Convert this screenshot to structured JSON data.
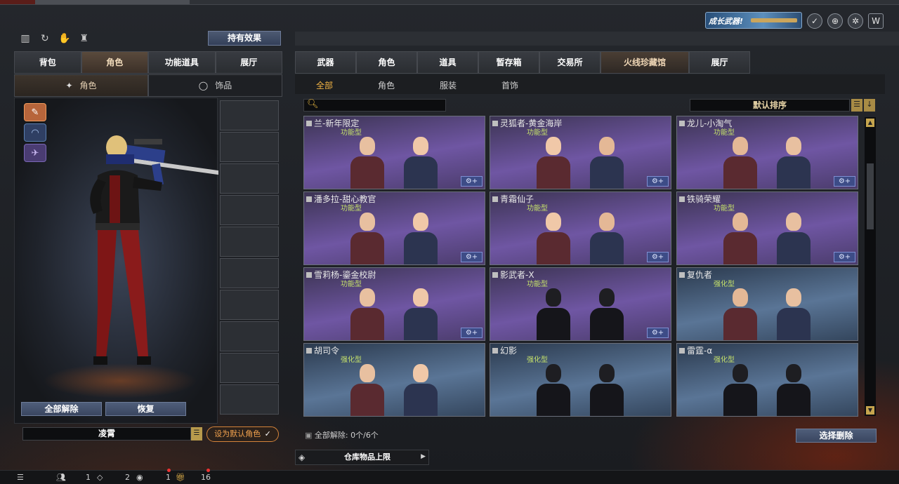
{
  "promo": {
    "label": "成长武器!"
  },
  "left_panel": {
    "effect_button": "持有效果",
    "tabs": [
      "背包",
      "角色",
      "功能道具",
      "展厅"
    ],
    "sub_tabs": [
      {
        "label": "角色",
        "icon": "character-icon"
      },
      {
        "label": "饰品",
        "icon": "ring-icon"
      }
    ],
    "unequip_all": "全部解除",
    "restore": "恢复",
    "character_name": "凌霄",
    "set_default": "设为默认角色",
    "set_default_mark": "✓"
  },
  "right_panel": {
    "tabs": [
      "武器",
      "角色",
      "道具",
      "暂存箱",
      "交易所",
      "火线珍藏馆",
      "展厅"
    ],
    "sub_tabs": [
      "全部",
      "角色",
      "服装",
      "首饰"
    ],
    "search_placeholder": "",
    "sort_label": "默认排序",
    "cards": [
      {
        "name": "兰-新年限定",
        "type": "功能型",
        "style": "purple",
        "add": true
      },
      {
        "name": "灵狐者-黄金海岸",
        "type": "功能型",
        "style": "purple",
        "add": true
      },
      {
        "name": "龙儿-小淘气",
        "type": "功能型",
        "style": "purple",
        "add": true
      },
      {
        "name": "潘多拉-甜心教官",
        "type": "功能型",
        "style": "purple",
        "add": true
      },
      {
        "name": "青霜仙子",
        "type": "功能型",
        "style": "purple",
        "add": true
      },
      {
        "name": "铁骑荣耀",
        "type": "功能型",
        "style": "purple",
        "add": true
      },
      {
        "name": "雪莉杨-鎏金校尉",
        "type": "功能型",
        "style": "purple",
        "add": true
      },
      {
        "name": "影武者-X",
        "type": "功能型",
        "style": "purple",
        "add": true
      },
      {
        "name": "复仇者",
        "type": "强化型",
        "style": "blue",
        "add": false
      },
      {
        "name": "胡司令",
        "type": "强化型",
        "style": "blue",
        "add": false
      },
      {
        "name": "幻影",
        "type": "强化型",
        "style": "blue",
        "add": false
      },
      {
        "name": "雷霆-α",
        "type": "强化型",
        "style": "blue",
        "add": false
      }
    ],
    "unequip_status": "全部解除: 0个/6个",
    "select_delete": "选择删除",
    "warehouse_limit": "仓库物品上限"
  },
  "bottom_bar": {
    "counts": [
      "1",
      "2",
      "1",
      "16"
    ]
  },
  "colors": {
    "accent_orange": "#f3b444",
    "functional_type": "#c4e06a",
    "card_purple": "#6f56a3",
    "card_blue": "#5a7596"
  }
}
